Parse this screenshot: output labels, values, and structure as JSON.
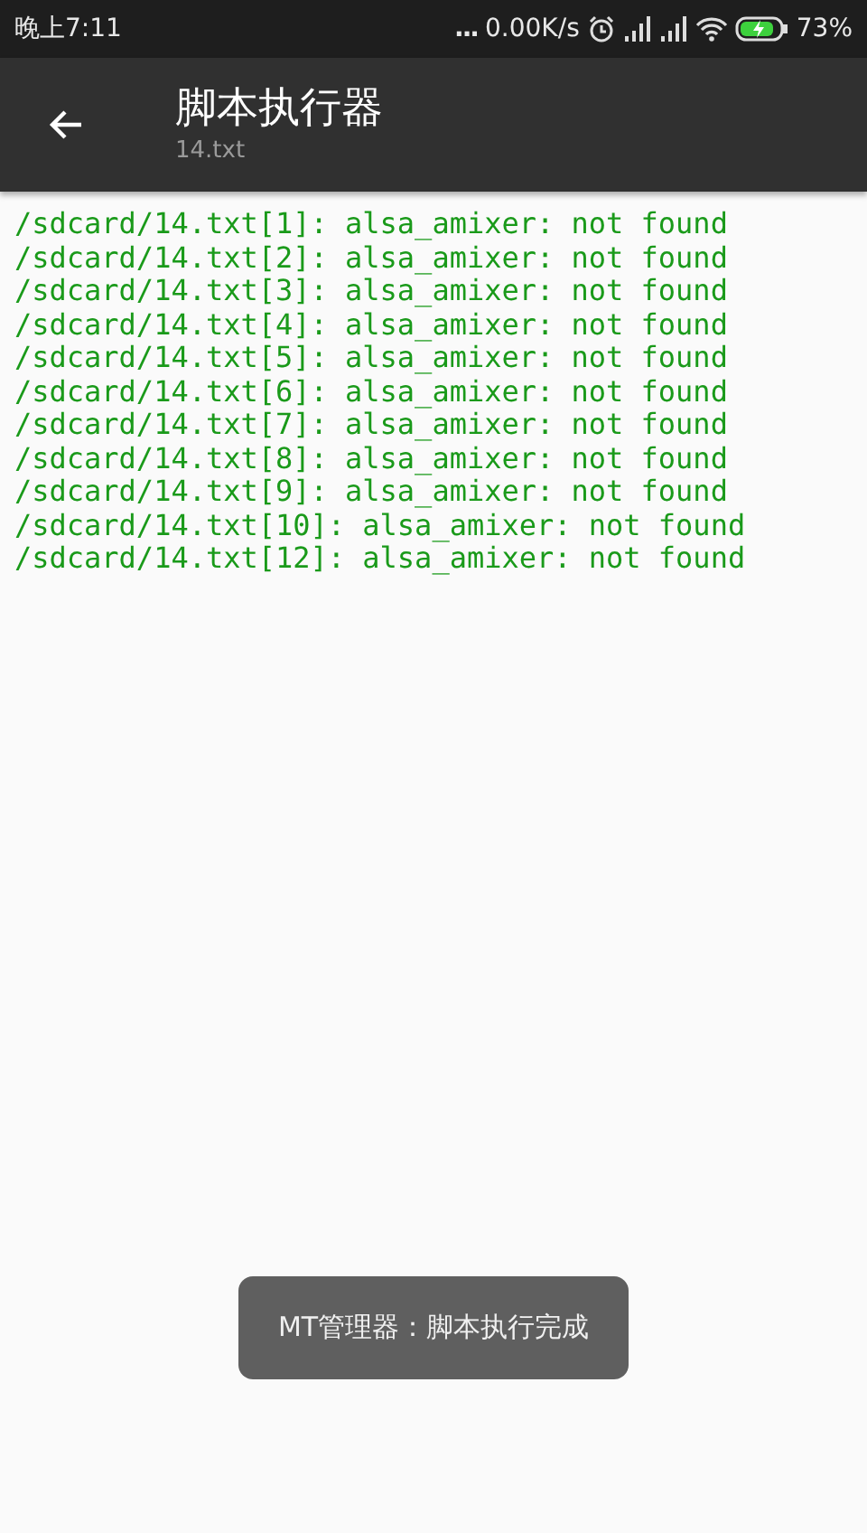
{
  "status_bar": {
    "time": "晚上7:11",
    "more": "...",
    "speed": "0.00K/s",
    "battery": "73%"
  },
  "toolbar": {
    "title": "脚本执行器",
    "subtitle": "14.txt"
  },
  "output_lines": [
    "/sdcard/14.txt[1]: alsa_amixer: not found",
    "/sdcard/14.txt[2]: alsa_amixer: not found",
    "/sdcard/14.txt[3]: alsa_amixer: not found",
    "/sdcard/14.txt[4]: alsa_amixer: not found",
    "/sdcard/14.txt[5]: alsa_amixer: not found",
    "/sdcard/14.txt[6]: alsa_amixer: not found",
    "/sdcard/14.txt[7]: alsa_amixer: not found",
    "/sdcard/14.txt[8]: alsa_amixer: not found",
    "/sdcard/14.txt[9]: alsa_amixer: not found",
    "/sdcard/14.txt[10]: alsa_amixer: not found",
    "/sdcard/14.txt[12]: alsa_amixer: not found"
  ],
  "toast": "MT管理器：脚本执行完成"
}
